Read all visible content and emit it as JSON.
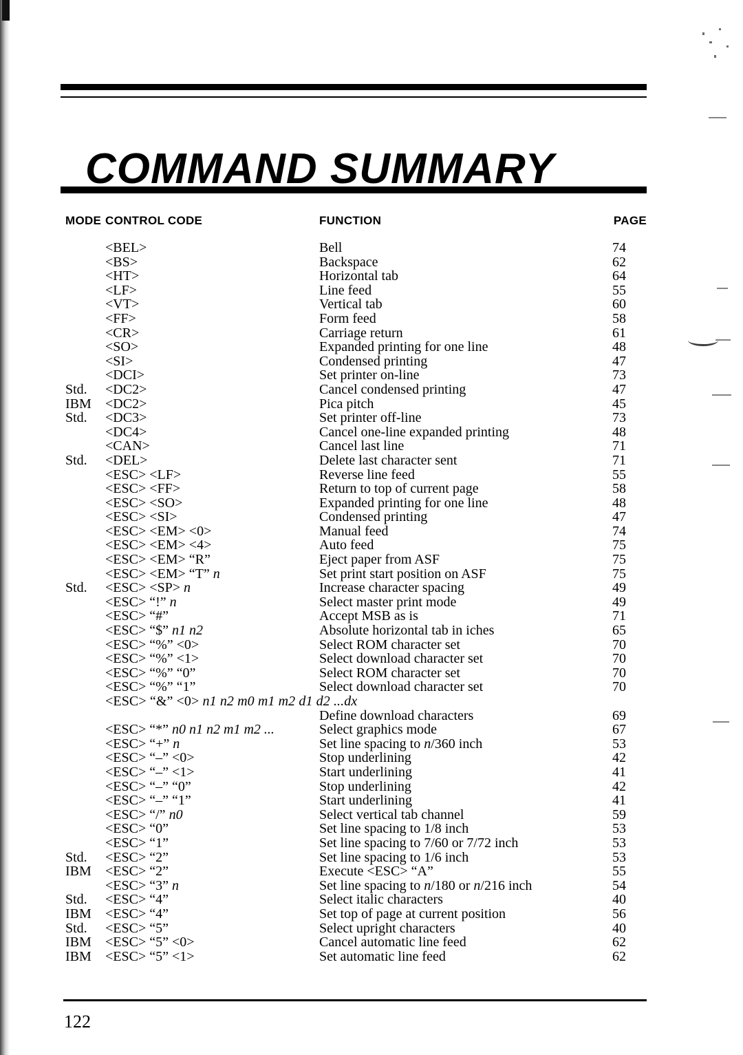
{
  "document": {
    "title": "COMMAND SUMMARY",
    "page_number": "122"
  },
  "table": {
    "headers": {
      "mode": "MODE",
      "control_code": "CONTROL CODE",
      "function": "FUNCTION",
      "page": "PAGE"
    },
    "rows": [
      {
        "mode": "",
        "code": "<BEL>",
        "function": "Bell",
        "page": "74"
      },
      {
        "mode": "",
        "code": "<BS>",
        "function": "Backspace",
        "page": "62"
      },
      {
        "mode": "",
        "code": "<HT>",
        "function": "Horizontal tab",
        "page": "64"
      },
      {
        "mode": "",
        "code": "<LF>",
        "function": "Line feed",
        "page": "55"
      },
      {
        "mode": "",
        "code": "<VT>",
        "function": "Vertical tab",
        "page": "60"
      },
      {
        "mode": "",
        "code": "<FF>",
        "function": "Form feed",
        "page": "58"
      },
      {
        "mode": "",
        "code": "<CR>",
        "function": "Carriage return",
        "page": "61"
      },
      {
        "mode": "",
        "code": "<SO>",
        "function": "Expanded printing for one line",
        "page": "48"
      },
      {
        "mode": "",
        "code": "<SI>",
        "function": "Condensed printing",
        "page": "47"
      },
      {
        "mode": "",
        "code": "<DCI>",
        "function": "Set printer on-line",
        "page": "73"
      },
      {
        "mode": "Std.",
        "code": "<DC2>",
        "function": "Cancel condensed printing",
        "page": "47"
      },
      {
        "mode": "IBM",
        "code": "<DC2>",
        "function": "Pica pitch",
        "page": "45"
      },
      {
        "mode": "Std.",
        "code": "<DC3>",
        "function": "Set printer off-line",
        "page": "73"
      },
      {
        "mode": "",
        "code": "<DC4>",
        "function": "Cancel one-line expanded printing",
        "page": "48"
      },
      {
        "mode": "",
        "code": "<CAN>",
        "function": "Cancel last line",
        "page": "71"
      },
      {
        "mode": "Std.",
        "code": "<DEL>",
        "function": "Delete last character sent",
        "page": "71"
      },
      {
        "mode": "",
        "code": "<ESC> <LF>",
        "function": "Reverse line feed",
        "page": "55"
      },
      {
        "mode": "",
        "code": "<ESC> <FF>",
        "function": "Return to top of current page",
        "page": "58"
      },
      {
        "mode": "",
        "code": "<ESC> <SO>",
        "function": "Expanded printing for one line",
        "page": "48"
      },
      {
        "mode": "",
        "code": "<ESC> <SI>",
        "function": "Condensed printing",
        "page": "47"
      },
      {
        "mode": "",
        "code": "<ESC> <EM> <0>",
        "function": "Manual feed",
        "page": "74"
      },
      {
        "mode": "",
        "code": "<ESC> <EM> <4>",
        "function": "Auto feed",
        "page": "75"
      },
      {
        "mode": "",
        "code": "<ESC> <EM> “R”",
        "function": "Eject paper from ASF",
        "page": "75"
      },
      {
        "mode": "",
        "code": "<ESC> <EM> “T” n",
        "code_italic_tail": "n",
        "function": "Set print start position on ASF",
        "page": "75"
      },
      {
        "mode": "Std.",
        "code": "<ESC> <SP> n",
        "code_italic_tail": "n",
        "function": "Increase character spacing",
        "page": "49"
      },
      {
        "mode": "",
        "code": "<ESC> “!” n",
        "code_italic_tail": "n",
        "function": "Select master print mode",
        "page": "49"
      },
      {
        "mode": "",
        "code": "<ESC> “#”",
        "function": "Accept MSB as is",
        "page": "71"
      },
      {
        "mode": "",
        "code": "<ESC> “$” n1 n2",
        "code_italic_tail": "n1 n2",
        "function": "Absolute horizontal tab in iches",
        "page": "65"
      },
      {
        "mode": "",
        "code": "<ESC> “%” <0>",
        "function": "Select ROM character set",
        "page": "70"
      },
      {
        "mode": "",
        "code": "<ESC> “%” <1>",
        "function": "Select download character set",
        "page": "70"
      },
      {
        "mode": "",
        "code": "<ESC> “%” “0”",
        "function": "Select ROM character set",
        "page": "70"
      },
      {
        "mode": "",
        "code": "<ESC> “%” “1”",
        "function": "Select download character set",
        "page": "70"
      },
      {
        "mode": "",
        "code": "<ESC> “&” <0> n1 n2 m0 m1 m2 d1 d2 ...dx",
        "code_italic_tail": "n1 n2 m0 m1 m2 d1 d2 ...dx",
        "function": "",
        "page": "",
        "wide": true
      },
      {
        "mode": "",
        "code": "",
        "function": "Define download characters",
        "page": "69"
      },
      {
        "mode": "",
        "code": "<ESC> “*” n0 n1 n2 m1 m2 ...",
        "code_italic_tail": "n0 n1 n2 m1 m2 ...",
        "function": "Select graphics mode",
        "page": "67"
      },
      {
        "mode": "",
        "code": "<ESC> “+” n",
        "code_italic_tail": "n",
        "function": "Set line spacing to n/360 inch",
        "function_italic": "n",
        "page": "53"
      },
      {
        "mode": "",
        "code": "<ESC> “–” <0>",
        "function": "Stop underlining",
        "page": "42"
      },
      {
        "mode": "",
        "code": "<ESC> “–” <1>",
        "function": "Start underlining",
        "page": "41"
      },
      {
        "mode": "",
        "code": "<ESC> “–” “0”",
        "function": "Stop underlining",
        "page": "42"
      },
      {
        "mode": "",
        "code": "<ESC> “–” “1”",
        "function": "Start underlining",
        "page": "41"
      },
      {
        "mode": "",
        "code": "<ESC> “/” n0",
        "code_italic_tail": "n0",
        "function": "Select vertical tab channel",
        "page": "59"
      },
      {
        "mode": "",
        "code": "<ESC> “0”",
        "function": "Set line spacing to 1/8 inch",
        "page": "53"
      },
      {
        "mode": "",
        "code": "<ESC> “1”",
        "function": "Set line spacing to 7/60 or 7/72 inch",
        "page": "53"
      },
      {
        "mode": "Std.",
        "code": "<ESC> “2”",
        "function": "Set line spacing to 1/6 inch",
        "page": "53"
      },
      {
        "mode": "IBM",
        "code": "<ESC> “2”",
        "function": "Execute <ESC> “A”",
        "page": "55"
      },
      {
        "mode": "",
        "code": "<ESC> “3” n",
        "code_italic_tail": "n",
        "function": "Set line spacing to n/180 or n/216 inch",
        "function_italic": "n",
        "page": "54"
      },
      {
        "mode": "Std.",
        "code": "<ESC> “4”",
        "function": "Select italic characters",
        "page": "40"
      },
      {
        "mode": "IBM",
        "code": "<ESC> “4”",
        "function": "Set top of page at current position",
        "page": "56"
      },
      {
        "mode": "Std.",
        "code": "<ESC> “5”",
        "function": "Select upright characters",
        "page": "40"
      },
      {
        "mode": "IBM",
        "code": "<ESC> “5” <0>",
        "function": "Cancel automatic line feed",
        "page": "62"
      },
      {
        "mode": "IBM",
        "code": "<ESC> “5” <1>",
        "function": "Set automatic line feed",
        "page": "62"
      }
    ]
  }
}
